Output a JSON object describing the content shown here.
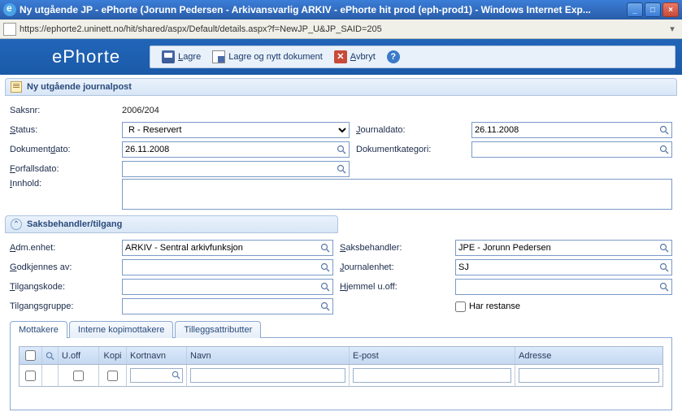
{
  "window": {
    "title": "Ny utgående JP - ePhorte (Jorunn Pedersen - Arkivansvarlig ARKIV - ePhorte hit prod (eph-prod1) - Windows Internet Exp...",
    "url": "https://ephorte2.uninett.no/hit/shared/aspx/Default/details.aspx?f=NewJP_U&JP_SAID=205"
  },
  "app": {
    "logo": "ePhorte",
    "toolbar": {
      "save": "Lagre",
      "save_new": "Lagre og nytt dokument",
      "cancel": "Avbryt"
    }
  },
  "section_main": {
    "title": "Ny utgående journalpost"
  },
  "form": {
    "saksnr_label": "Saksnr:",
    "saksnr_value": "2006/204",
    "status_label": "Status:",
    "status_value": "R - Reservert",
    "journaldato_label": "Journaldato:",
    "journaldato_value": "26.11.2008",
    "dokdato_label": "Dokumentdato:",
    "dokdato_value": "26.11.2008",
    "dokkat_label": "Dokumentkategori:",
    "dokkat_value": "",
    "forfall_label": "Forfallsdato:",
    "forfall_value": "",
    "innhold_label": "Innhold:",
    "innhold_value": ""
  },
  "section_access": {
    "title": "Saksbehandler/tilgang"
  },
  "access": {
    "admenhet_label": "Adm.enhet:",
    "admenhet_value": "ARKIV - Sentral arkivfunksjon",
    "saksbeh_label": "Saksbehandler:",
    "saksbeh_value": "JPE - Jorunn Pedersen",
    "godkj_label": "Godkjennes av:",
    "godkj_value": "",
    "journalenhet_label": "Journalenhet:",
    "journalenhet_value": "SJ",
    "tilgkode_label": "Tilgangskode:",
    "tilgkode_value": "",
    "hjemmel_label": "Hjemmel u.off:",
    "hjemmel_value": "",
    "tilggruppe_label": "Tilgangsgruppe:",
    "tilggruppe_value": "",
    "restanse_label": "Har restanse"
  },
  "tabs": {
    "t1": "Mottakere",
    "t2": "Interne kopimottakere",
    "t3": "Tilleggsattributter"
  },
  "table": {
    "h_uoff": "U.off",
    "h_kopi": "Kopi",
    "h_short": "Kortnavn",
    "h_navn": "Navn",
    "h_epost": "E-post",
    "h_adr": "Adresse"
  }
}
